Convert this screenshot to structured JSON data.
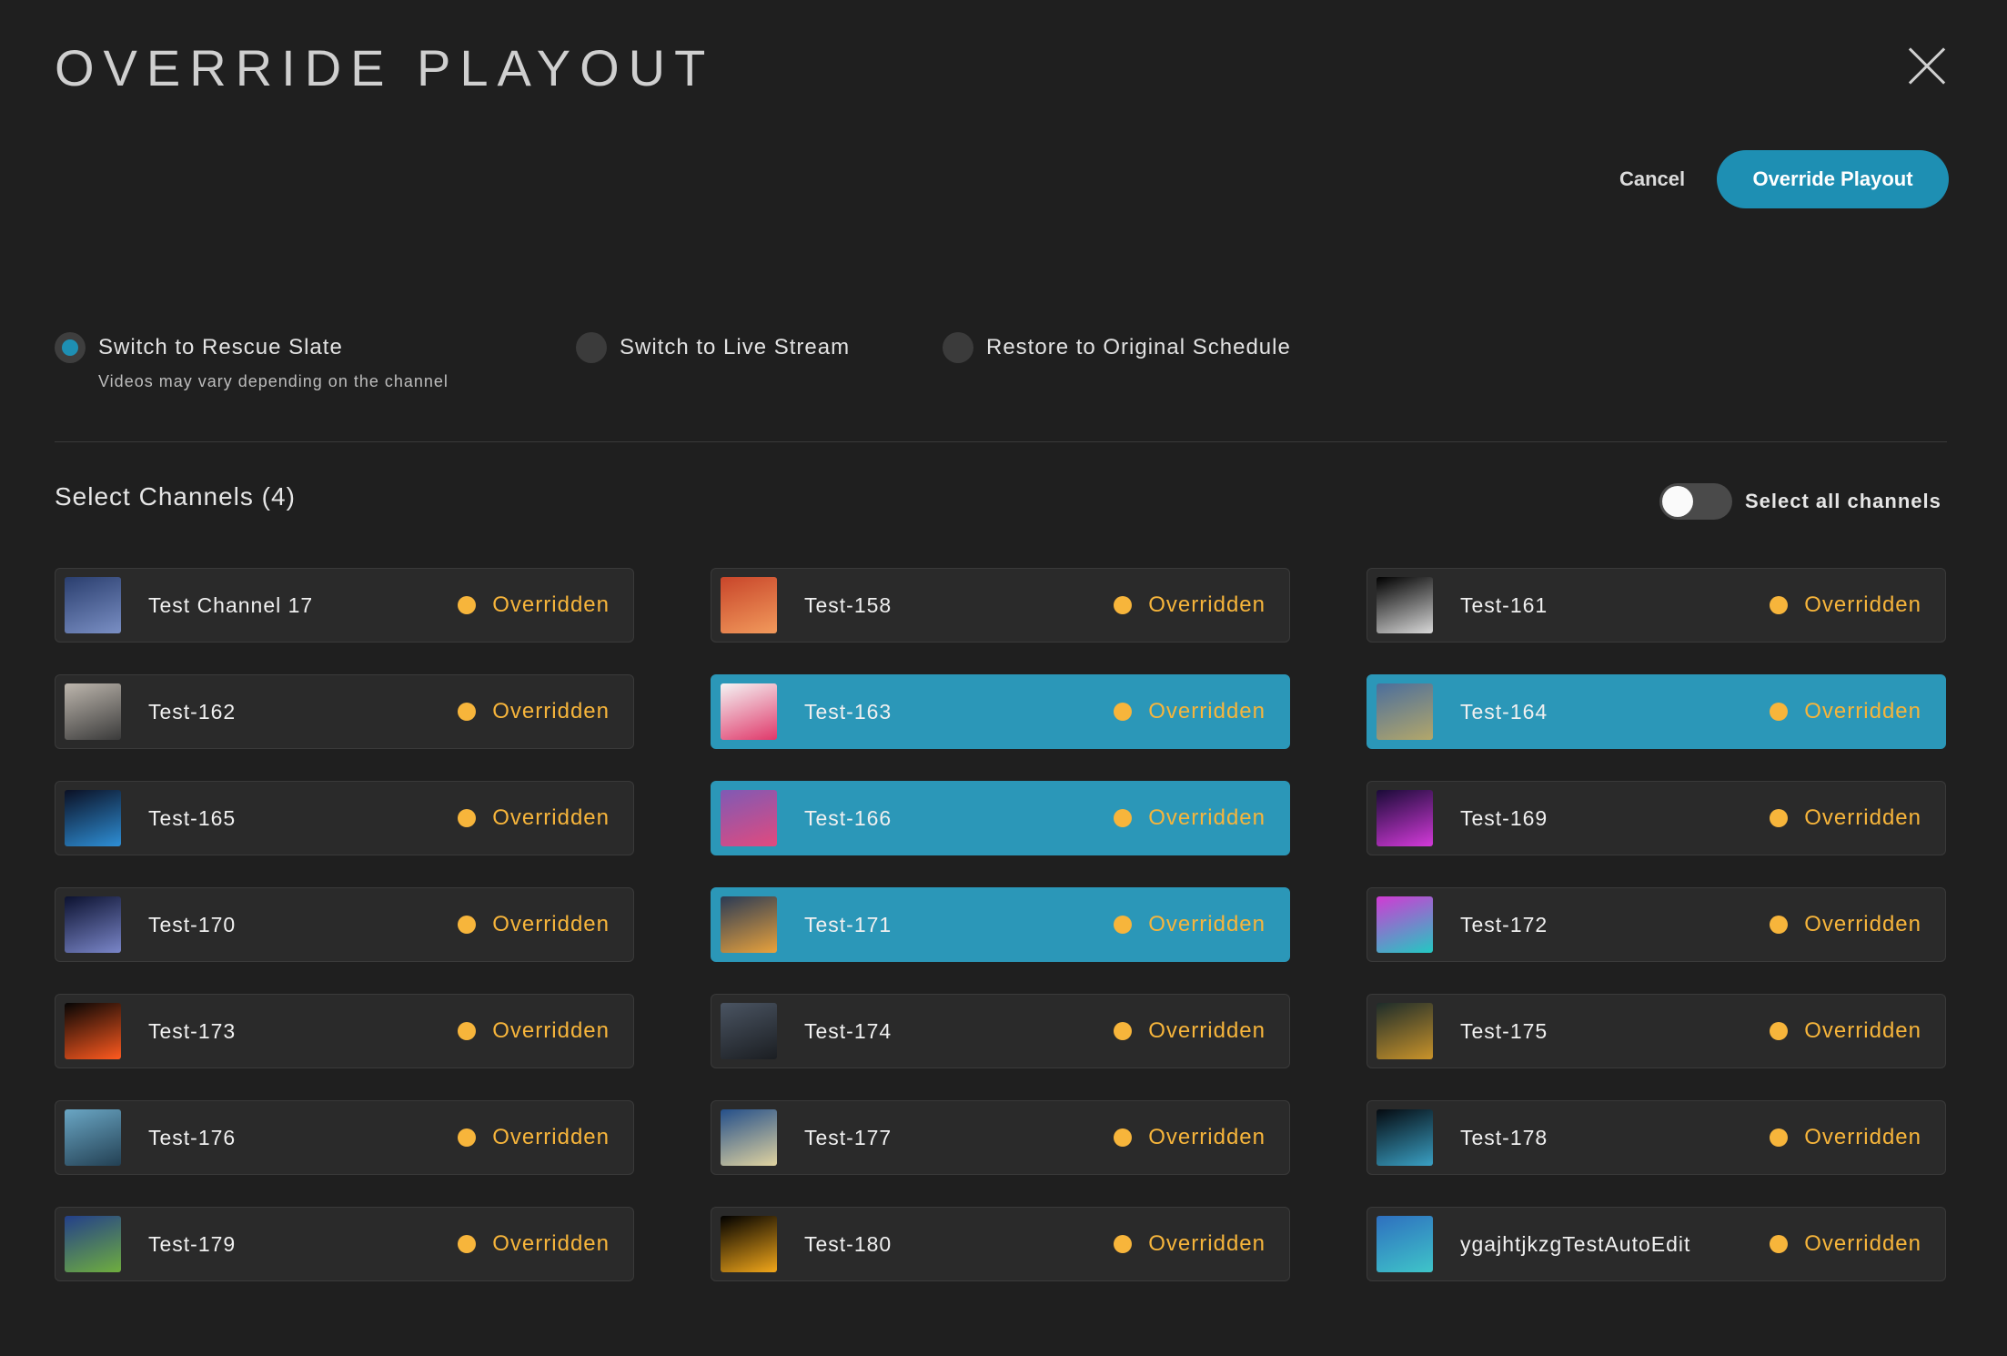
{
  "header": {
    "title": "OVERRIDE PLAYOUT"
  },
  "actions": {
    "cancel_label": "Cancel",
    "override_label": "Override Playout"
  },
  "options": [
    {
      "label": "Switch to Rescue Slate",
      "sublabel": "Videos may vary depending on the channel",
      "checked": true
    },
    {
      "label": "Switch to Live Stream",
      "sublabel": "",
      "checked": false
    },
    {
      "label": "Restore to Original Schedule",
      "sublabel": "",
      "checked": false
    }
  ],
  "channels_section": {
    "title": "Select Channels (4)",
    "select_all_label": "Select all channels",
    "select_all_on": false
  },
  "status_label": "Overridden",
  "colors": {
    "accent": "#1e8fb3",
    "selected_card": "#2b97b8",
    "status": "#f7b53b",
    "background": "#1f1f1f"
  },
  "channels": [
    {
      "name": "Test Channel 17",
      "selected": false,
      "thumb": [
        "#2a3e6e",
        "#7a8fc4"
      ]
    },
    {
      "name": "Test-158",
      "selected": false,
      "thumb": [
        "#c8452a",
        "#f29a5c"
      ]
    },
    {
      "name": "Test-161",
      "selected": false,
      "thumb": [
        "#000000",
        "#d9d9d9"
      ]
    },
    {
      "name": "Test-162",
      "selected": false,
      "thumb": [
        "#bdb6ad",
        "#3a3a3a"
      ]
    },
    {
      "name": "Test-163",
      "selected": true,
      "thumb": [
        "#f4f4f4",
        "#e0386a"
      ]
    },
    {
      "name": "Test-164",
      "selected": true,
      "thumb": [
        "#4b6e9c",
        "#b3a76a"
      ]
    },
    {
      "name": "Test-165",
      "selected": false,
      "thumb": [
        "#0b1024",
        "#2e8fd6"
      ]
    },
    {
      "name": "Test-166",
      "selected": true,
      "thumb": [
        "#7f5ab5",
        "#e14a7e"
      ]
    },
    {
      "name": "Test-169",
      "selected": false,
      "thumb": [
        "#1a0b38",
        "#d33ad9"
      ]
    },
    {
      "name": "Test-170",
      "selected": false,
      "thumb": [
        "#0c1230",
        "#7a86c9"
      ]
    },
    {
      "name": "Test-171",
      "selected": true,
      "thumb": [
        "#2a3a55",
        "#e9a23c"
      ]
    },
    {
      "name": "Test-172",
      "selected": false,
      "thumb": [
        "#d13ad4",
        "#22c9c2"
      ]
    },
    {
      "name": "Test-173",
      "selected": false,
      "thumb": [
        "#050505",
        "#ff5a1f"
      ]
    },
    {
      "name": "Test-174",
      "selected": false,
      "thumb": [
        "#4a5462",
        "#1b1e22"
      ]
    },
    {
      "name": "Test-175",
      "selected": false,
      "thumb": [
        "#1d2c2a",
        "#c9932a"
      ]
    },
    {
      "name": "Test-176",
      "selected": false,
      "thumb": [
        "#6aa6c4",
        "#234053"
      ]
    },
    {
      "name": "Test-177",
      "selected": false,
      "thumb": [
        "#244f8a",
        "#e0d3a0"
      ]
    },
    {
      "name": "Test-178",
      "selected": false,
      "thumb": [
        "#050a10",
        "#3aa0c4"
      ]
    },
    {
      "name": "Test-179",
      "selected": false,
      "thumb": [
        "#233f8a",
        "#6fae3e"
      ]
    },
    {
      "name": "Test-180",
      "selected": false,
      "thumb": [
        "#000000",
        "#f2a71a"
      ]
    },
    {
      "name": "ygajhtjkzgTestAutoEdit",
      "selected": false,
      "thumb": [
        "#2e6fbf",
        "#3fc5c9"
      ]
    }
  ]
}
